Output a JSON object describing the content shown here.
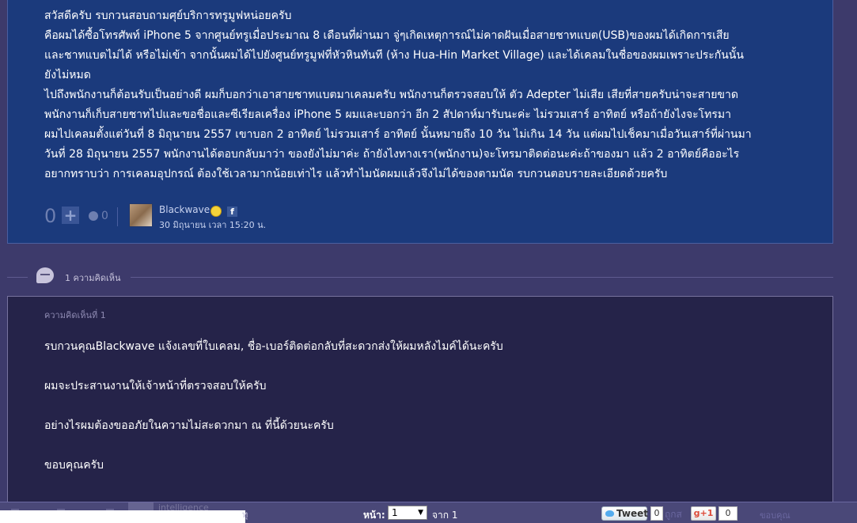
{
  "post": {
    "lines": [
      "สวัสดีครับ รบกวนสอบถามศุย์บริการทรูมูฟหน่อยครับ",
      "คือผมได้ซื้อโทรศัพท์ iPhone 5 จากศูนย์ทรูเมื่อประมาณ 8 เดือนที่ผ่านมา จู่ๆเกิดเหตุการณ์ไม่คาดฝันเมื่อสายชาทแบต(USB)ของผมได้เกิดการเสีย",
      "และชาทแบตไม่ได้ หรือไม่เข้า จากนั้นผมได้ไปยังศูนย์ทรูมูฟที่หัวหินทันที (ห้าง Hua-Hin Market Village) และได้เคลมในชื่อของผมเพราะประกันนั้น",
      "ยังไม่หมด",
      "ไปถึงพนักงานก็ต้อนรับเป็นอย่างดี ผมก็บอกว่าเอาสายชาทแบตมาเคลมครับ พนักงานก็ตรวจสอบให้ ตัว Adepter ไม่เสีย เสียที่สายครับน่าจะสายขาด",
      "พนักงานก็เก็บสายชาทไปและขอชื่อและซีเรียลเครื่อง iPhone 5 ผมและบอกว่า อีก 2 สัปดาห์มารับนะค่ะ ไม่รวมเสาร์ อาทิตย์ หรือถ้ายังไงจะโทรมา",
      "ผมไปเคลมตั้งแต่วันที่ 8 มิถุนายน 2557 เขาบอก 2 อาทิตย์ ไม่รวมเสาร์ อาทิตย์ นั้นหมายถึง 10 วัน ไม่เกิน 14 วัน แต่ผมไปเช็คมาเมื่อวันเสาร์ที่ผ่านมา",
      "วันที่ 28 มิถุนายน 2557 พนักงานได้ตอบกลับมาว่า ของยังไม่มาค่ะ ถ้ายังไงทางเรา(พนักงาน)จะโทรมาติดต่อนะค่ะถ้าของมา แล้ว 2 อาทิตย์คืออะไร",
      "อยากทราบว่า การเคลมอุปกรณ์ ต้องใช้เวลามากน้อยเท่าไร แล้วทำไมนัดผมแล้วจึงไม่ได้ของตามนัด รบกวนตอบรายละเอียดด้วยครับ"
    ],
    "vote_count": "0",
    "vote_plus": "+",
    "emo_count": "0",
    "author": "Blackwave",
    "fb_letter": "f",
    "date": "30 มิถุนายน เวลา 15:20 น."
  },
  "comments_header": {
    "count_label": "1 ความคิดเห็น"
  },
  "comment": {
    "number_label": "ความคิดเห็นที่ 1",
    "lines": [
      "รบกวนคุณBlackwave แจ้งเลขที่ใบเคลม, ชื่อ-เบอร์ติดต่อกลับที่สะดวกส่งให้ผมหลังไมค์ได้นะครับ",
      "ผมจะประสานงานให้เจ้าหน้าที่ตรวจสอบให้ครับ",
      "อย่างไรผมต้องขออภัยในความไม่สะดวกมา ณ ที่นี้ด้วยนะครับ",
      "ขอบคุณครับ"
    ]
  },
  "bottom_bar": {
    "ghost_name": "intelligence",
    "ghost_suffix": "ทุ",
    "page_label": "หน้า:",
    "page_value": "1",
    "page_arrow": "▼",
    "page_of": "จาก 1",
    "tweet_label": "Tweet",
    "tweet_count": "0",
    "ghost_text2": "ถูกส",
    "gplus_label": "g+1",
    "gplus_count": "0",
    "ghost_text3": "ขอบคุณ"
  }
}
